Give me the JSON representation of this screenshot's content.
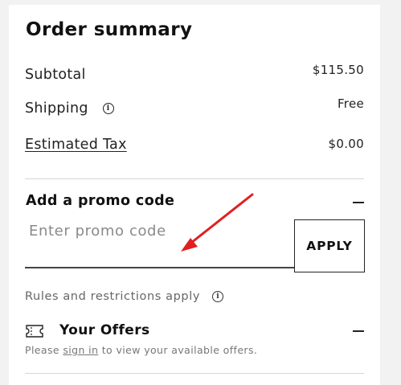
{
  "summary": {
    "title": "Order summary",
    "subtotal_label": "Subtotal",
    "subtotal_value": "$115.50",
    "shipping_label": "Shipping",
    "shipping_value": "Free",
    "tax_label": "Estimated Tax",
    "tax_value": "$0.00"
  },
  "promo": {
    "title": "Add a promo code",
    "placeholder": "Enter promo code",
    "value": "",
    "apply_label": "APPLY",
    "rules_text": "Rules and restrictions apply"
  },
  "offers": {
    "title": "Your Offers",
    "prefix": "Please ",
    "sign_in_link": "sign in",
    "suffix": " to view your available offers."
  },
  "icons": {
    "info": "info-icon",
    "collapse": "minus-icon",
    "ticket": "ticket-icon",
    "annotation": "red-arrow"
  },
  "colors": {
    "annotation_arrow": "#e02020",
    "panel_background": "#ffffff",
    "page_background": "#f2f2f2"
  }
}
